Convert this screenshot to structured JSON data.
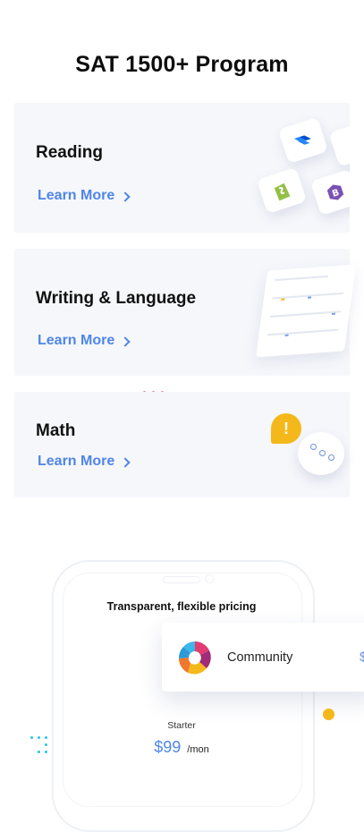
{
  "page": {
    "title": "SAT 1500+ Program"
  },
  "cards": [
    {
      "title": "Reading",
      "link": "Learn More"
    },
    {
      "title": "Writing & Language",
      "link": "Learn More"
    },
    {
      "title": "Math",
      "link": "Learn More"
    }
  ],
  "pricing": {
    "title": "Transparent, flexible pricing",
    "community": {
      "label": "Community",
      "price_prefix": "$"
    },
    "plan": {
      "name": "Starter",
      "price": "$99",
      "period": "/mon"
    }
  },
  "icons": {
    "reading": [
      "jira-icon",
      "shopify-icon",
      "bootstrap-icon",
      "app-icon"
    ],
    "writing": [
      "dashboard-illustration"
    ],
    "math": [
      "exclamation-bubble-icon",
      "chat-bubble-icon"
    ],
    "community": "community-logo-icon"
  },
  "colors": {
    "accent": "#4f86e8",
    "card_bg": "#f6f7fb",
    "yellow": "#f5b81b",
    "cyan": "#27c4e8",
    "shopify_green": "#95bf47",
    "bootstrap_purple": "#7952b3"
  }
}
